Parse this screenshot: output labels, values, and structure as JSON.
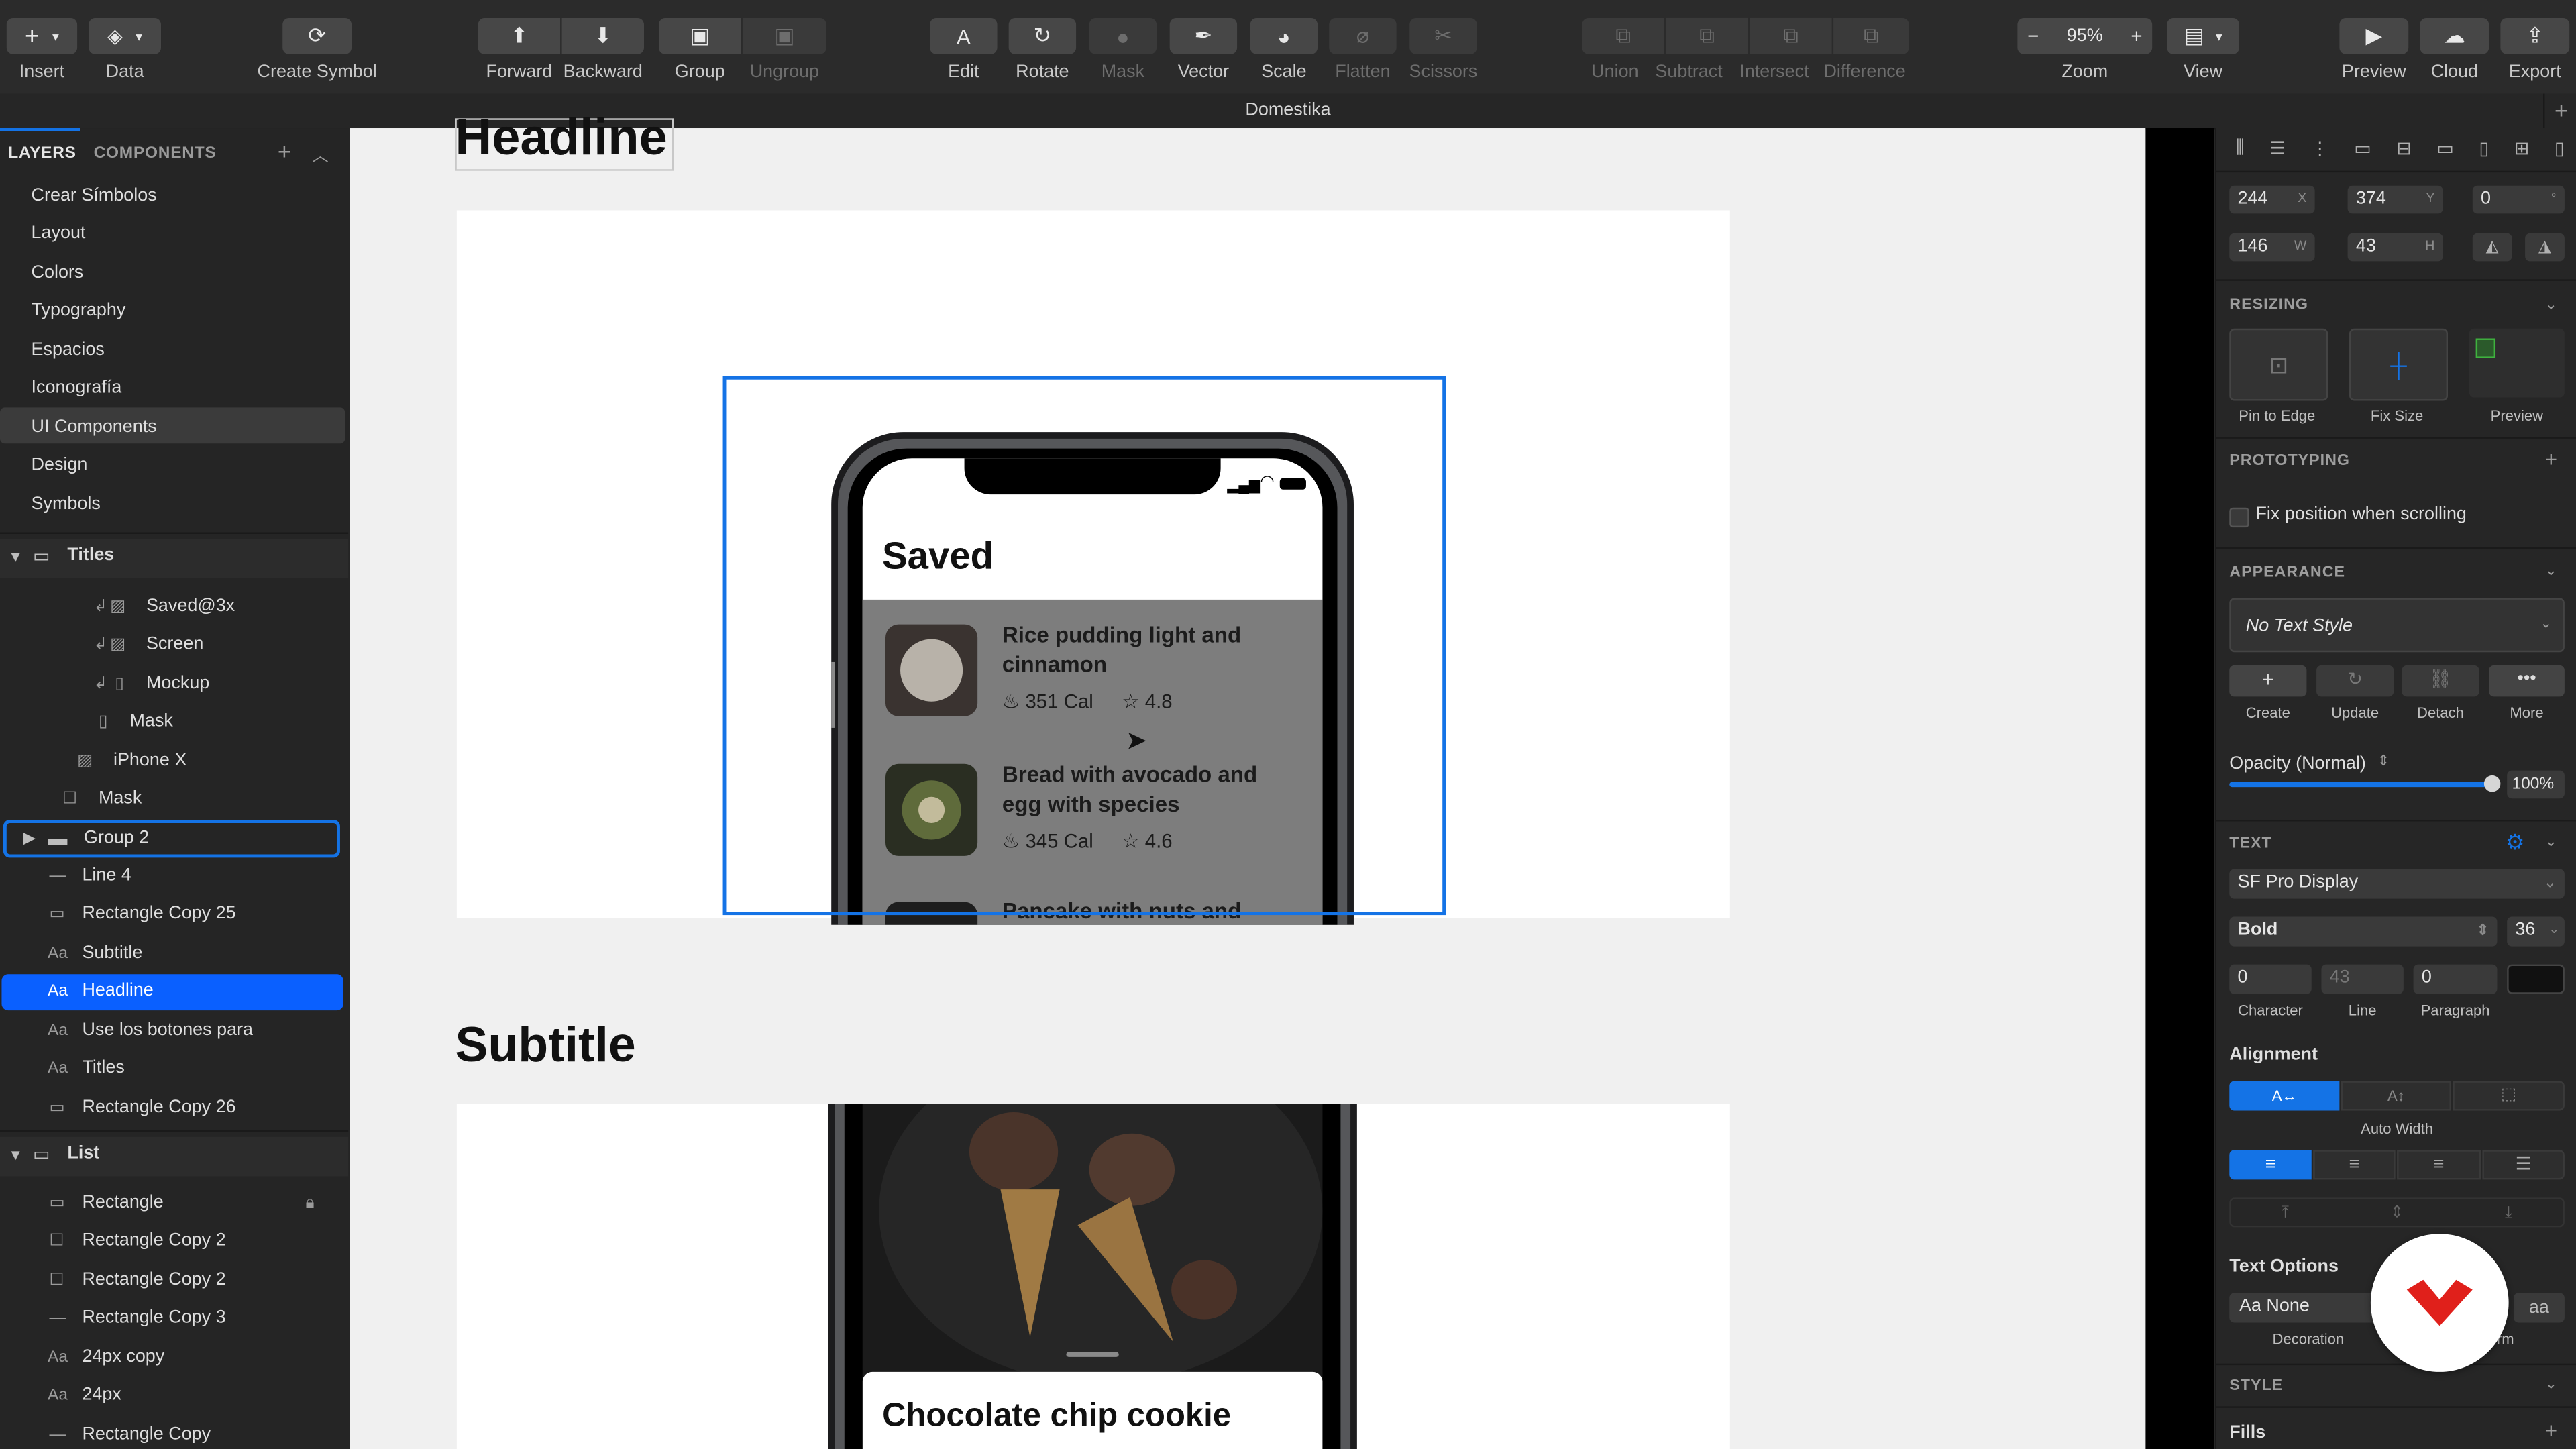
{
  "toolbar": {
    "items": [
      {
        "label": "Insert",
        "icon": "plus-icon"
      },
      {
        "label": "Data",
        "icon": "data-icon"
      },
      {
        "label": "Create Symbol",
        "icon": "symbol-icon"
      },
      {
        "label": "Forward",
        "icon": "forward-icon"
      },
      {
        "label": "Backward",
        "icon": "backward-icon"
      },
      {
        "label": "Group",
        "icon": "group-icon"
      },
      {
        "label": "Ungroup",
        "icon": "ungroup-icon"
      },
      {
        "label": "Edit",
        "icon": "edit-icon"
      },
      {
        "label": "Rotate",
        "icon": "rotate-icon"
      },
      {
        "label": "Mask",
        "icon": "mask-icon"
      },
      {
        "label": "Vector",
        "icon": "vector-pen-icon"
      },
      {
        "label": "Scale",
        "icon": "scale-icon"
      },
      {
        "label": "Flatten",
        "icon": "flatten-icon"
      },
      {
        "label": "Scissors",
        "icon": "scissors-icon"
      },
      {
        "label": "Union",
        "icon": "union-icon"
      },
      {
        "label": "Subtract",
        "icon": "subtract-icon"
      },
      {
        "label": "Intersect",
        "icon": "intersect-icon"
      },
      {
        "label": "Difference",
        "icon": "difference-icon"
      },
      {
        "label": "Zoom",
        "icon": "zoom-icon"
      },
      {
        "label": "View",
        "icon": "view-icon"
      },
      {
        "label": "Preview",
        "icon": "play-icon"
      },
      {
        "label": "Cloud",
        "icon": "cloud-icon"
      },
      {
        "label": "Export",
        "icon": "export-icon"
      }
    ],
    "zoom_value": "95%",
    "zoom_minus": "−",
    "zoom_plus": "+"
  },
  "document": {
    "title": "Domestika"
  },
  "sidebar": {
    "tab_layers": "LAYERS",
    "tab_components": "COMPONENTS",
    "pages": [
      "Crear Símbolos",
      "Layout",
      "Colors",
      "Typography",
      "Espacios",
      "Iconografía",
      "UI Components",
      "Design",
      "Symbols"
    ],
    "selected_page": "UI Components",
    "groups": [
      {
        "name": "Titles",
        "layers": [
          "Saved@3x",
          "Screen",
          "Mockup",
          "Mask",
          "iPhone X",
          "Mask",
          "Group 2",
          "Line 4",
          "Rectangle Copy 25",
          "Subtitle",
          "Headline",
          "Use los botones para",
          "Titles",
          "Rectangle Copy 26"
        ]
      },
      {
        "name": "List",
        "layers": [
          "Rectangle",
          "Rectangle Copy 2",
          "Rectangle Copy 2",
          "Rectangle Copy 3",
          "24px copy",
          "24px",
          "Rectangle Copy"
        ]
      }
    ],
    "selected_layer": "Headline",
    "highlighted_layer": "Group 2"
  },
  "canvas": {
    "headline": "Headline",
    "subtitle": "Subtitle",
    "phone1": {
      "screen_title": "Saved",
      "recipes": [
        {
          "name": "Rice pudding light and cinnamon",
          "cal": "351 Cal",
          "rating": "4.8"
        },
        {
          "name": "Bread with avocado and egg with species",
          "cal": "345 Cal",
          "rating": "4.6"
        },
        {
          "name": "Pancake with nuts and",
          "cal": "",
          "rating": ""
        }
      ]
    },
    "phone2": {
      "card_title": "Chocolate chip cookie"
    }
  },
  "inspector": {
    "x": "244",
    "x_unit": "X",
    "y": "374",
    "y_unit": "Y",
    "rotation": "0",
    "rotation_unit": "°",
    "w": "146",
    "w_unit": "W",
    "h": "43",
    "h_unit": "H",
    "resizing": {
      "title": "RESIZING",
      "pin_to_edge": "Pin to Edge",
      "fix_size": "Fix Size",
      "preview": "Preview"
    },
    "prototyping": {
      "title": "PROTOTYPING",
      "fix_position": "Fix position when scrolling"
    },
    "appearance": {
      "title": "APPEARANCE",
      "text_style": "No Text Style",
      "buttons": [
        "Create",
        "Update",
        "Detach",
        "More"
      ],
      "opacity_label": "Opacity (Normal)",
      "opacity_value": "100%",
      "opacity": 1.0
    },
    "text": {
      "title": "TEXT",
      "font": "SF Pro Display",
      "weight": "Bold",
      "size": "36",
      "character": "0",
      "line": "43",
      "paragraph": "0",
      "character_label": "Character",
      "line_label": "Line",
      "paragraph_label": "Paragraph",
      "alignment_title": "Alignment",
      "auto_width": "Auto Width",
      "text_options_title": "Text Options",
      "decoration_value": "Aa None",
      "decoration_label": "Decoration",
      "transform_value": "aa",
      "transform_label": "rm"
    },
    "style": {
      "title": "STYLE",
      "fills": "Fills"
    }
  },
  "colors": {
    "accent": "#1473e6",
    "selection_blue": "#0a60ff",
    "brand_red": "#e0201b"
  }
}
